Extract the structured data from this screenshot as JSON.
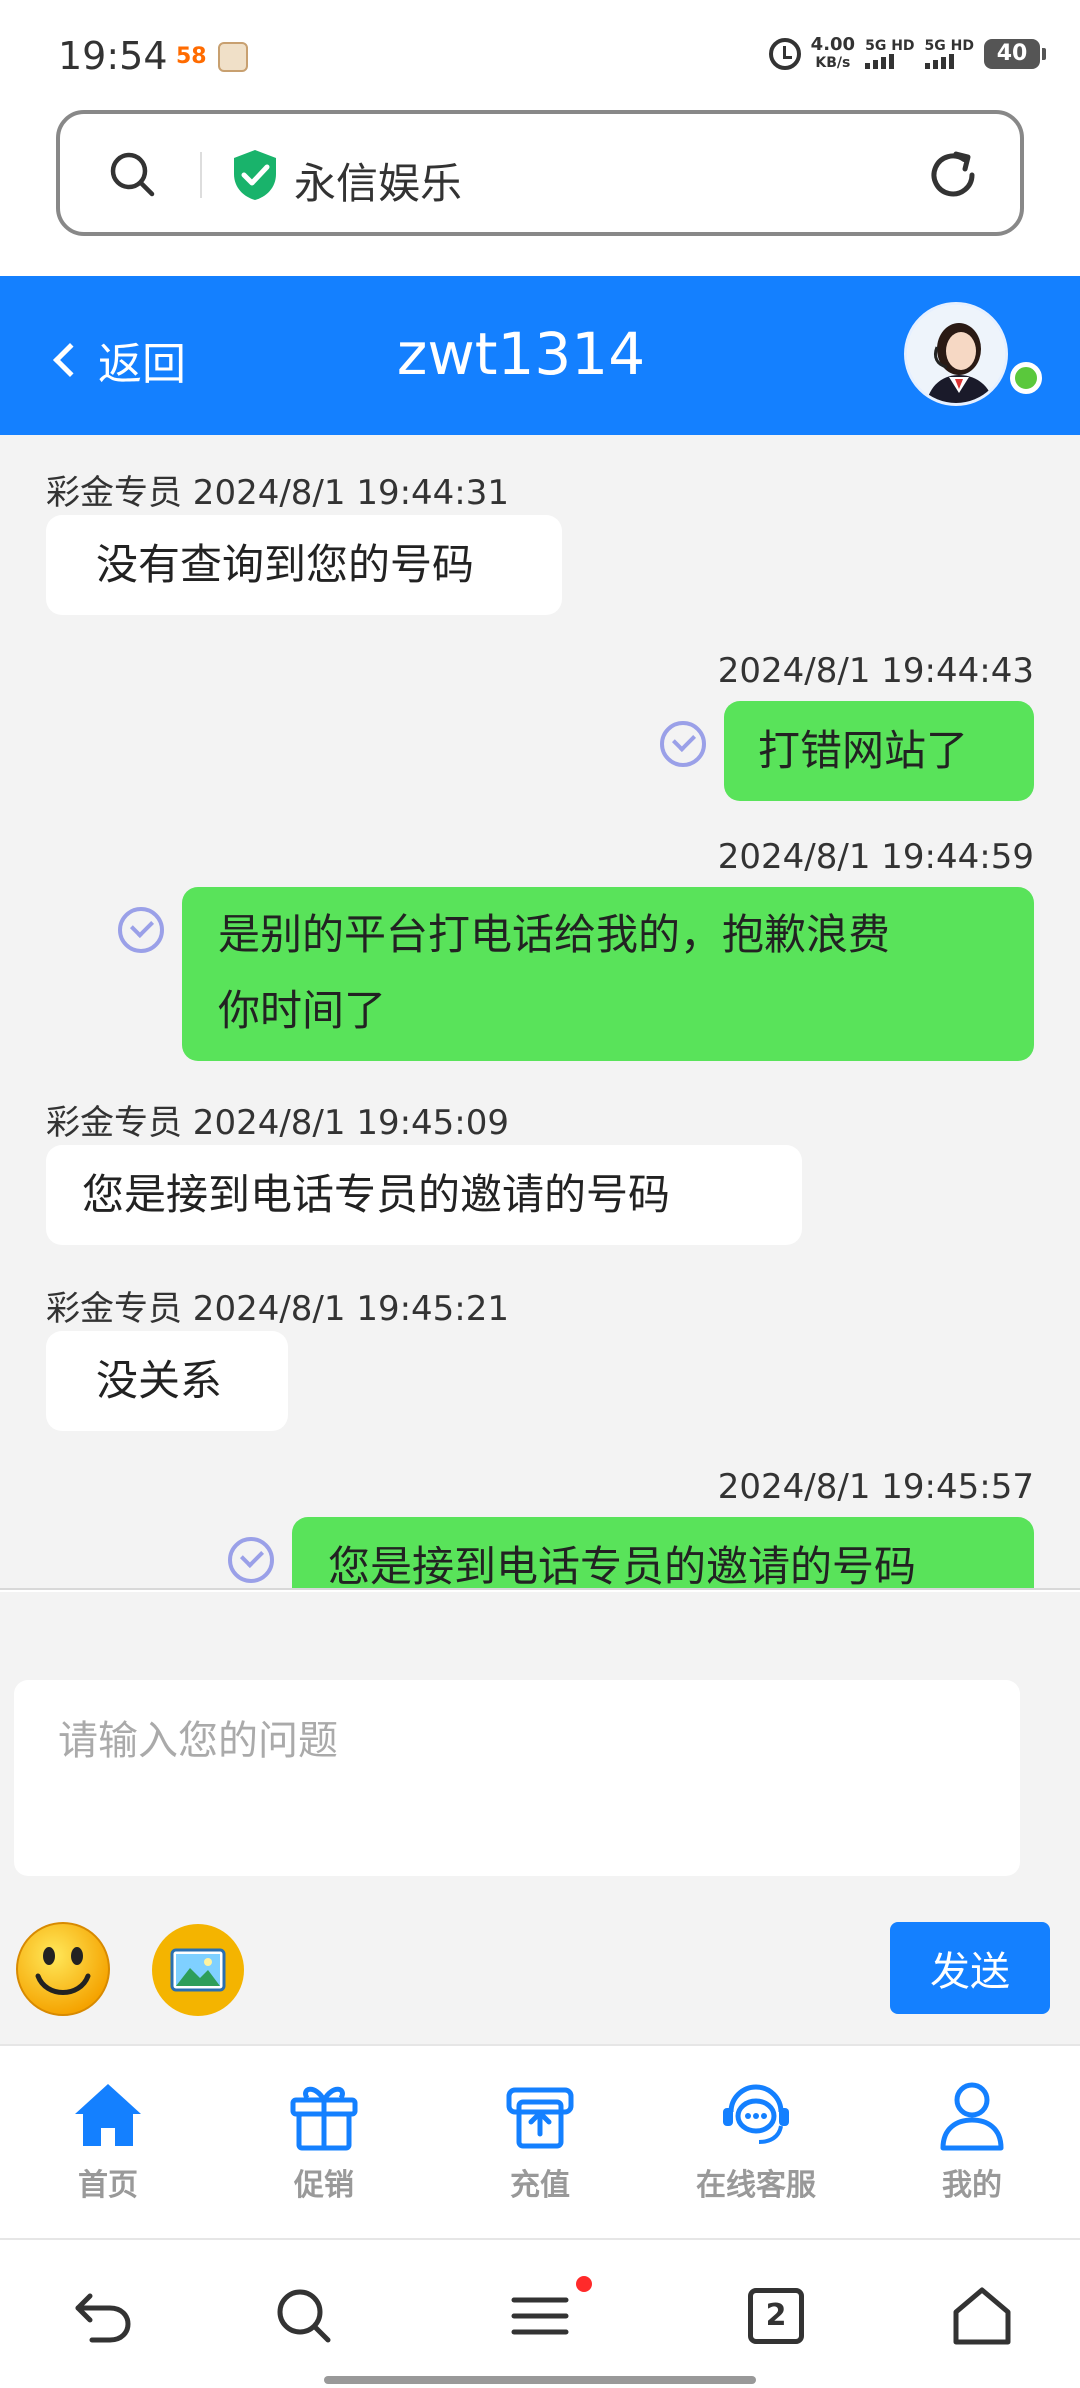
{
  "status_bar": {
    "time": "19:54",
    "app_badge": "58",
    "net_speed_value": "4.00",
    "net_speed_unit": "KB/s",
    "sim1_label": "5G HD",
    "sim2_label": "5G HD",
    "battery": "40"
  },
  "url_bar": {
    "site_title": "永信娱乐",
    "secure_color": "#19b36b"
  },
  "chat_header": {
    "back_label": "返回",
    "title": "zwt1314",
    "online": true,
    "header_color": "#1480ff"
  },
  "messages": [
    {
      "direction": "in",
      "meta": "彩金专员 2024/8/1 19:44:31",
      "text_lines": [
        "没有查询到您的号码"
      ]
    },
    {
      "direction": "out",
      "meta": "2024/8/1 19:44:43",
      "text_lines": [
        "打错网站了"
      ],
      "read": true
    },
    {
      "direction": "out",
      "meta": "2024/8/1 19:44:59",
      "text_lines": [
        "是别的平台打电话给我的，抱歉浪费",
        "你时间了"
      ],
      "read": true
    },
    {
      "direction": "in",
      "meta": "彩金专员 2024/8/1 19:45:09",
      "text_lines": [
        "您是接到电话专员的邀请的号码"
      ]
    },
    {
      "direction": "in",
      "meta": "彩金专员 2024/8/1 19:45:21",
      "text_lines": [
        "没关系"
      ]
    },
    {
      "direction": "out",
      "meta": "2024/8/1 19:45:57",
      "text_lines": [
        "您是接到电话专员的邀请的号码"
      ],
      "read": true
    }
  ],
  "composer": {
    "placeholder": "请输入您的问题",
    "value": "",
    "send_label": "发送",
    "emoji_icon": "smiley-emoji-icon",
    "image_icon": "picture-icon"
  },
  "bottom_nav": {
    "items": [
      {
        "label": "首页",
        "icon": "home-icon",
        "active": true
      },
      {
        "label": "促销",
        "icon": "gift-icon",
        "active": false
      },
      {
        "label": "充值",
        "icon": "deposit-icon",
        "active": false
      },
      {
        "label": "在线客服",
        "icon": "chat-support-icon",
        "active": false
      },
      {
        "label": "我的",
        "icon": "user-icon",
        "active": false
      }
    ]
  },
  "system_nav": {
    "tab_count": "2",
    "menu_has_notification": true
  }
}
